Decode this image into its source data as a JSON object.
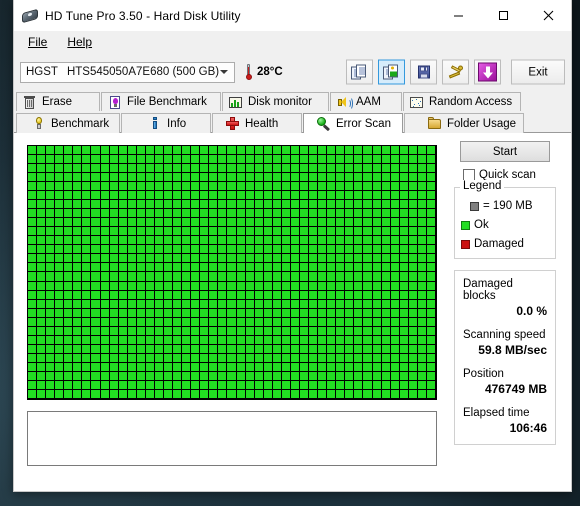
{
  "window": {
    "title": "HD Tune Pro 3.50 - Hard Disk Utility",
    "icon": "hard-disk-icon",
    "minimize": "—",
    "maximize": "□",
    "close": "×"
  },
  "menu": {
    "items": [
      {
        "label": "File",
        "accel": "F"
      },
      {
        "label": "Help",
        "accel": "H"
      }
    ]
  },
  "toolbar": {
    "drive_vendor": "HGST",
    "drive_model": "HTS545050A7E680 (500 GB)",
    "dropdown_icon": "chevron-down-icon",
    "temperature": "28°C",
    "thermometer_icon": "thermometer-icon",
    "buttons": [
      {
        "name": "copy-info-button",
        "icon": "copy-pages-icon",
        "selected": false
      },
      {
        "name": "copy-screenshot-button",
        "icon": "copy-image-icon",
        "selected": true
      },
      {
        "name": "save-button",
        "icon": "floppy-disk-icon",
        "selected": false
      },
      {
        "name": "options-button",
        "icon": "tools-icon",
        "selected": false
      },
      {
        "name": "download-button",
        "icon": "purple-down-arrow-icon",
        "selected": false
      }
    ],
    "exit_label": "Exit"
  },
  "tabs": {
    "row1": [
      {
        "label": "Erase",
        "icon": "trash-icon",
        "active": false
      },
      {
        "label": "File Benchmark",
        "icon": "file-benchmark-icon",
        "active": false
      },
      {
        "label": "Disk monitor",
        "icon": "bar-chart-icon",
        "active": false
      },
      {
        "label": "AAM",
        "icon": "speaker-icon",
        "active": false
      },
      {
        "label": "Random Access",
        "icon": "scatter-icon",
        "active": false
      }
    ],
    "row2": [
      {
        "label": "Benchmark",
        "icon": "lightbulb-icon",
        "active": false
      },
      {
        "label": "Info",
        "icon": "info-icon",
        "active": false
      },
      {
        "label": "Health",
        "icon": "red-cross-icon",
        "active": false
      },
      {
        "label": "Error Scan",
        "icon": "magnifier-icon",
        "active": true
      },
      {
        "label": "Folder Usage",
        "icon": "folder-icon",
        "active": false
      }
    ]
  },
  "scan": {
    "columns": 45,
    "rows": 28,
    "ok_color": "#22dd22",
    "damaged_color": "#cc1111",
    "grid_line_color": "#000000",
    "log_text": ""
  },
  "side": {
    "start_label": "Start",
    "quick_scan_label": "Quick scan",
    "quick_scan_checked": false,
    "legend": {
      "title": "Legend",
      "rows": [
        {
          "label": "= 190 MB",
          "color": "#808080"
        },
        {
          "label": "Ok",
          "color": "#22dd22"
        },
        {
          "label": "Damaged",
          "color": "#cc1111"
        }
      ]
    },
    "stats": [
      {
        "label": "Damaged blocks",
        "value": "0.0 %"
      },
      {
        "label": "Scanning speed",
        "value": "59.8 MB/sec"
      },
      {
        "label": "Position",
        "value": "476749 MB"
      },
      {
        "label": "Elapsed time",
        "value": "106:46"
      }
    ]
  }
}
